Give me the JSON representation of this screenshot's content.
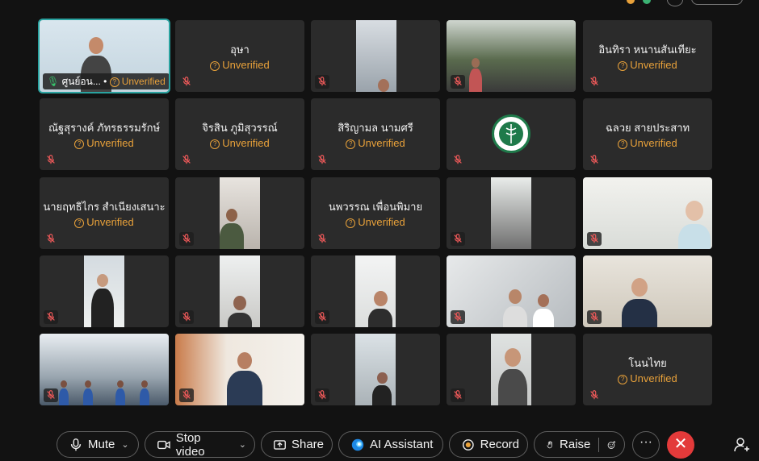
{
  "unverified_label": "Unverified",
  "participants": [
    {
      "id": "p1",
      "kind": "video",
      "name": "ศูนย์อน...",
      "show_label": true,
      "active": true
    },
    {
      "id": "p2",
      "kind": "name",
      "name": "อุษา"
    },
    {
      "id": "p3",
      "kind": "video"
    },
    {
      "id": "p4",
      "kind": "video"
    },
    {
      "id": "p5",
      "kind": "name",
      "name": "อินทิรา  หนานสันเทียะ"
    },
    {
      "id": "p6",
      "kind": "name",
      "name": "ณัฐสุรางค์ ภัทรธรรมรักษ์"
    },
    {
      "id": "p7",
      "kind": "name",
      "name": "จิรสิน ภูมิสุวรรณ์"
    },
    {
      "id": "p8",
      "kind": "name",
      "name": "สิริญามล นามศรี"
    },
    {
      "id": "p9",
      "kind": "logo"
    },
    {
      "id": "p10",
      "kind": "name",
      "name": "ฉลวย สายประสาท"
    },
    {
      "id": "p11",
      "kind": "name",
      "name": "นายฤทธิไกร สำเนียงเสนาะ"
    },
    {
      "id": "p12",
      "kind": "video"
    },
    {
      "id": "p13",
      "kind": "name",
      "name": "นพวรรณ เพื่อนพิมาย"
    },
    {
      "id": "p14",
      "kind": "video"
    },
    {
      "id": "p15",
      "kind": "video"
    },
    {
      "id": "p16",
      "kind": "video"
    },
    {
      "id": "p17",
      "kind": "video"
    },
    {
      "id": "p18",
      "kind": "video"
    },
    {
      "id": "p19",
      "kind": "video"
    },
    {
      "id": "p20",
      "kind": "video"
    },
    {
      "id": "p21",
      "kind": "video"
    },
    {
      "id": "p22",
      "kind": "video"
    },
    {
      "id": "p23",
      "kind": "video"
    },
    {
      "id": "p24",
      "kind": "video"
    },
    {
      "id": "p25",
      "kind": "name",
      "name": "โนนไทย"
    }
  ],
  "toolbar": {
    "mute_label": "Mute",
    "stop_video_label": "Stop video",
    "share_label": "Share",
    "ai_assistant_label": "AI Assistant",
    "record_label": "Record",
    "raise_label": "Raise",
    "more_label": "···",
    "end_label": "✕"
  },
  "colors": {
    "active_border": "#2aa3a0",
    "unverified": "#e8a13a",
    "end_call": "#e33a3a",
    "mute_icon": "#f05a5a"
  }
}
